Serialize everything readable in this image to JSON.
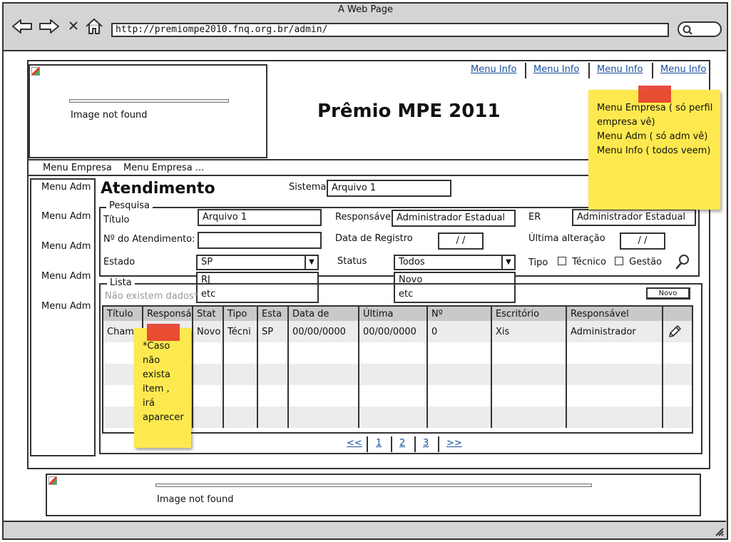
{
  "browser": {
    "window_title": "A Web Page",
    "url": "http://premiompe2010.fnq.org.br/admin/"
  },
  "header": {
    "logo_text": "Image not found",
    "title": "Prêmio MPE 2011",
    "menu_info": [
      "Menu Info",
      "Menu Info",
      "Menu Info",
      "Menu Info"
    ]
  },
  "top_menu": [
    "Menu Empresa",
    "Menu Empresa ..."
  ],
  "sidebar": {
    "items": [
      {
        "label": "Menu Adm"
      },
      {
        "label": "Menu Adm"
      },
      {
        "label": "Menu Adm"
      },
      {
        "label": "Menu Adm"
      },
      {
        "label": "Menu Adm"
      }
    ]
  },
  "page": {
    "title": "Atendimento",
    "sistema_label": "Sistema",
    "sistema_value": "Arquivo 1"
  },
  "pesquisa": {
    "legend": "Pesquisa",
    "titulo_label": "Título",
    "titulo_value": "Arquivo 1",
    "responsavel_label": "Responsável",
    "responsavel_value": "Administrador Estadual",
    "er_label": "ER",
    "er_value": "Administrador Estadual",
    "numero_label": "Nº do Atendimento:",
    "numero_value": "",
    "data_registro_label": "Data de Registro",
    "data_registro_value": "/ /",
    "ultima_alteracao_label": "Última alteração",
    "ultima_alteracao_value": "/ /",
    "estado_label": "Estado",
    "estado_selected": "SP",
    "estado_options": [
      "RJ",
      "etc"
    ],
    "status_label": "Status",
    "status_selected": "Todos",
    "status_options": [
      "Novo",
      "etc"
    ],
    "tipo_label": "Tipo",
    "tipo_tecnico": "Técnico",
    "tipo_gestao": "Gestão"
  },
  "lista": {
    "legend": "Lista",
    "empty_message": "Não existem dados*",
    "novo_button": "Novo",
    "columns": [
      "Título",
      "Responsá",
      "Stat",
      "Tipo",
      "Esta",
      "Data de",
      "Última",
      "Nº",
      "Escritório",
      "Responsável",
      ""
    ],
    "rows": [
      [
        "Chama",
        "",
        "Novo",
        "Técni",
        "SP",
        "00/00/0000",
        "00/00/0000",
        "0",
        "Xis",
        "Administrador"
      ]
    ],
    "pagination": [
      "<<",
      "1",
      "2",
      "3",
      ">>"
    ]
  },
  "notes": {
    "menu_note": [
      "Menu Empresa ( só perfil",
      "empresa vê)",
      "Menu Adm ( só adm vê)",
      "Menu Info ( todos veem)"
    ],
    "lista_note": [
      "*Caso",
      "não",
      "exista",
      "item ,",
      "irá",
      "aparecer"
    ]
  },
  "footer": {
    "image_text": "Image not found"
  },
  "colors": {
    "link": "#1a4fa0",
    "sticky_note": "#fde94f",
    "tape": "#e53b2e",
    "chrome": "#d4d4d4"
  },
  "icons": {
    "back": "arrow-left-icon",
    "forward": "arrow-right-icon",
    "stop": "close-icon",
    "home": "home-icon",
    "search": "search-icon",
    "edit": "pencil-icon",
    "resize": "resize-grip-icon"
  }
}
